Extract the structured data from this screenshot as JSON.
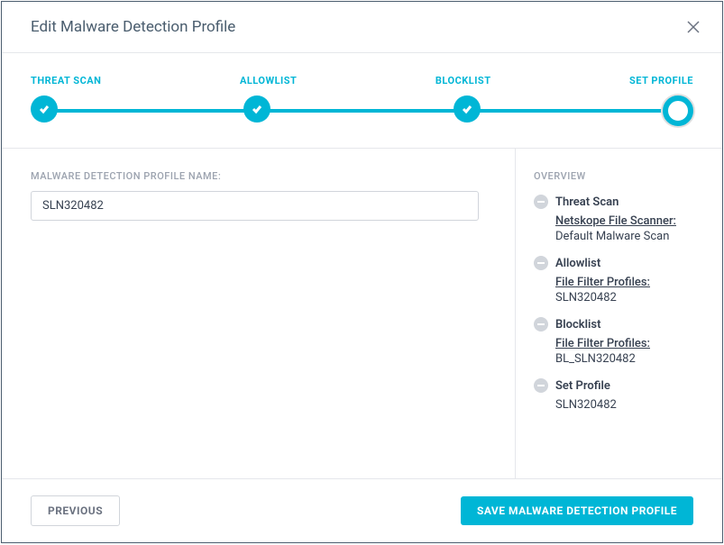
{
  "modal": {
    "title": "Edit Malware Detection Profile"
  },
  "stepper": {
    "steps": [
      {
        "label": "THREAT SCAN"
      },
      {
        "label": "ALLOWLIST"
      },
      {
        "label": "BLOCKLIST"
      },
      {
        "label": "SET PROFILE"
      }
    ]
  },
  "form": {
    "profile_name_label": "MALWARE DETECTION PROFILE NAME:",
    "profile_name_value": "SLN320482"
  },
  "overview": {
    "title": "OVERVIEW",
    "items": [
      {
        "title": "Threat Scan",
        "link": "Netskope File Scanner:",
        "value": "Default Malware Scan"
      },
      {
        "title": "Allowlist",
        "link": "File Filter Profiles:",
        "value": "SLN320482"
      },
      {
        "title": "Blocklist",
        "link": "File Filter Profiles:",
        "value": "BL_SLN320482"
      },
      {
        "title": "Set Profile",
        "link": "",
        "value": "SLN320482"
      }
    ]
  },
  "footer": {
    "previous_label": "PREVIOUS",
    "save_label": "SAVE MALWARE DETECTION PROFILE"
  }
}
